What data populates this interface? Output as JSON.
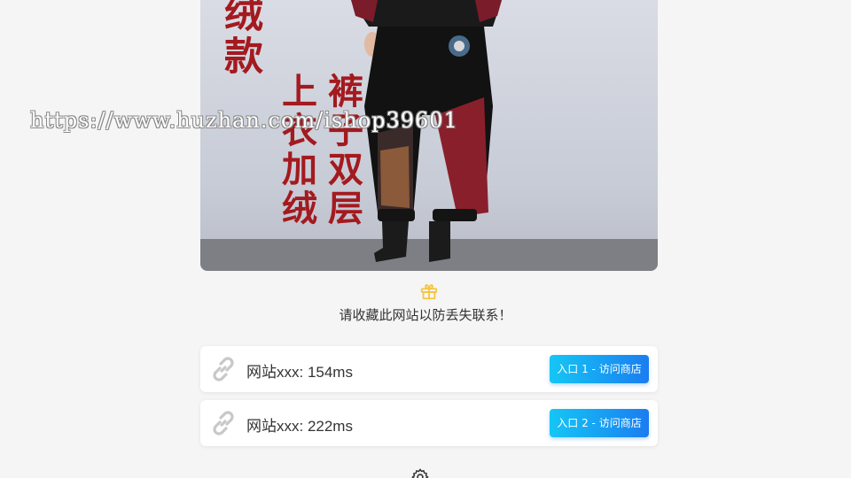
{
  "hero": {
    "promo_text_1": "绒款",
    "promo_text_2": "上衣加绒",
    "promo_text_3": "裤子双层"
  },
  "watermark": "https://www.huzhan.com/ishop39601",
  "notice": {
    "icon": "gift-icon",
    "text": "请收藏此网站以防丢失联系！"
  },
  "entries": [
    {
      "label": "网站xxx: 154ms",
      "button": "入口 1 - 访问商店",
      "icon": "link-icon"
    },
    {
      "label": "网站xxx: 222ms",
      "button": "入口 2 - 访问商店",
      "icon": "link-icon"
    }
  ],
  "footer": {
    "icon": "gear-icon"
  },
  "colors": {
    "accent_start": "#15c6f5",
    "accent_end": "#1a7df0",
    "gift": "#f5c542",
    "promo_red": "#a31a1f"
  }
}
